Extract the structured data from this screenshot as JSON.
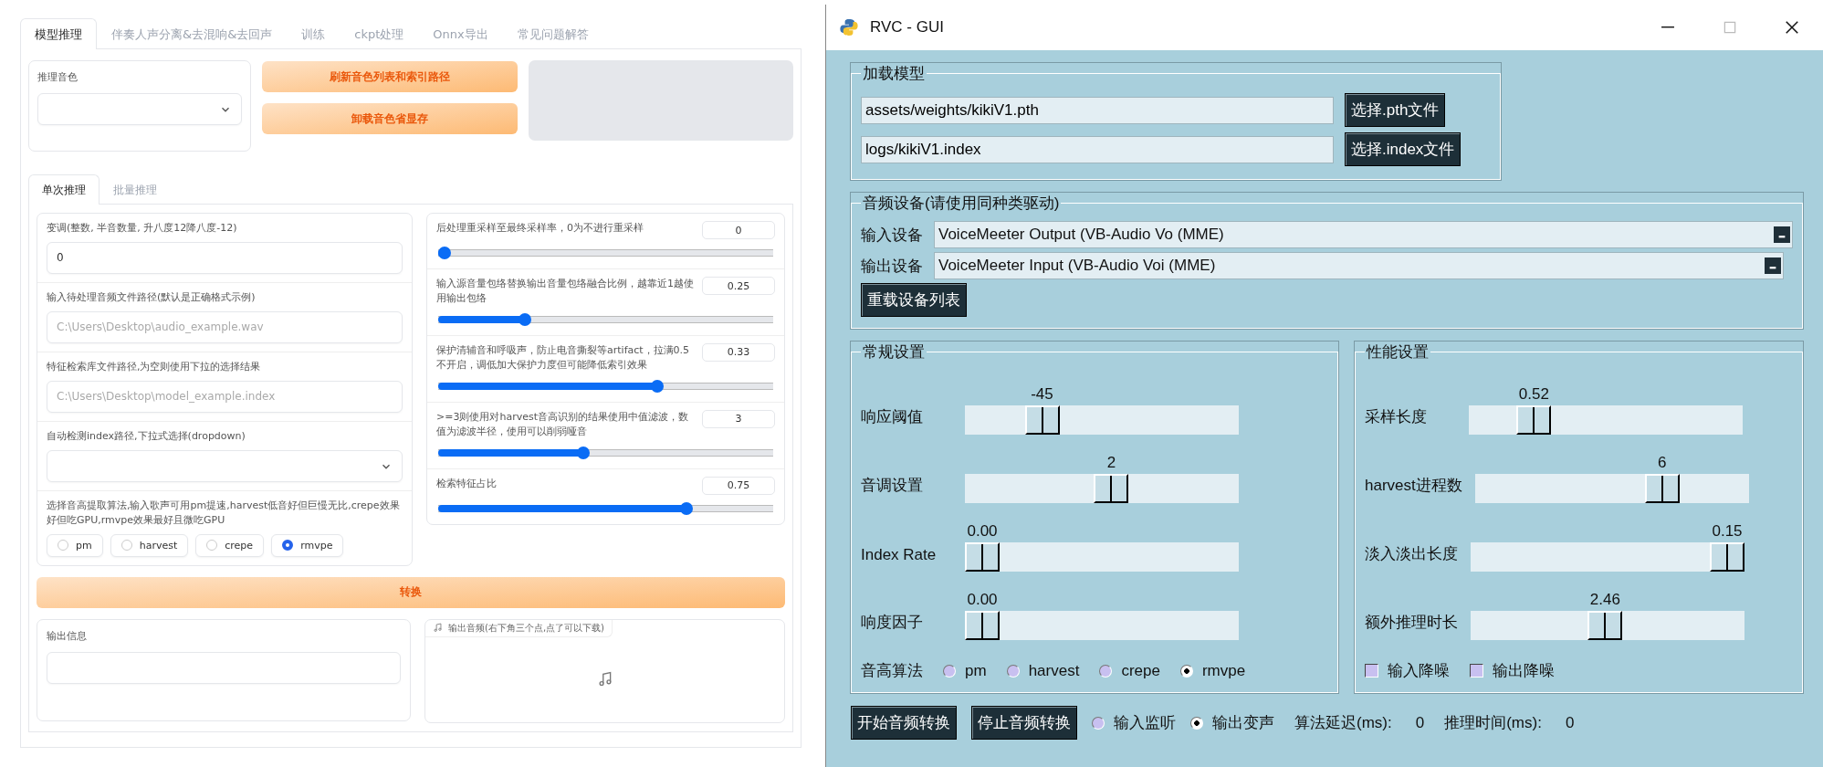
{
  "web_ui": {
    "tabs": [
      {
        "label": "模型推理",
        "selected": true
      },
      {
        "label": "伴奏人声分离&去混响&去回声",
        "selected": false
      },
      {
        "label": "训练",
        "selected": false
      },
      {
        "label": "ckpt处理",
        "selected": false
      },
      {
        "label": "Onnx导出",
        "selected": false
      },
      {
        "label": "常见问题解答",
        "selected": false
      }
    ],
    "voice_select": {
      "label": "推理音色"
    },
    "top_buttons": [
      "刷新音色列表和索引路径",
      "卸载音色省显存"
    ],
    "sub_tabs": [
      {
        "label": "单次推理",
        "selected": true
      },
      {
        "label": "批量推理",
        "selected": false
      }
    ],
    "fields": [
      {
        "kind": "text",
        "label": "变调(整数, 半音数量, 升八度12降八度-12)",
        "value": "0"
      },
      {
        "kind": "text",
        "label": "输入待处理音频文件路径(默认是正确格式示例)",
        "placeholder": "C:\\Users\\Desktop\\audio_example.wav"
      },
      {
        "kind": "text",
        "label": "特征检索库文件路径,为空则使用下拉的选择结果",
        "placeholder": "C:\\Users\\Desktop\\model_example.index"
      },
      {
        "kind": "dropdown",
        "label": "自动检测index路径,下拉式选择(dropdown)"
      },
      {
        "kind": "radio",
        "label": "选择音高提取算法,输入歌声可用pm提速,harvest低音好但巨慢无比,crepe效果好但吃GPU,rmvpe效果最好且微吃GPU",
        "options": [
          {
            "label": "pm",
            "selected": false
          },
          {
            "label": "harvest",
            "selected": false
          },
          {
            "label": "crepe",
            "selected": false
          },
          {
            "label": "rmvpe",
            "selected": true
          }
        ]
      }
    ],
    "sliders": [
      {
        "label": "后处理重采样至最终采样率，0为不进行重采样",
        "reading": "0",
        "level": 0
      },
      {
        "label": "输入源音量包络替换输出音量包络融合比例，越靠近1越使用输出包络",
        "reading": "0.25",
        "level": 0.25
      },
      {
        "label": "保护清辅音和呼吸声，防止电音撕裂等artifact，拉满0.5不开启，调低加大保护力度但可能降低索引效果",
        "reading": "0.33",
        "level": 0.66
      },
      {
        "label": ">=3则使用对harvest音高识别的结果使用中值滤波，数值为滤波半径，使用可以削弱哑音",
        "reading": "3",
        "level": 0.43
      },
      {
        "label": "检索特征占比",
        "reading": "0.75",
        "level": 0.75
      }
    ],
    "convert_button": "转换",
    "output_info": {
      "label": "输出信息"
    },
    "output_audio": {
      "label": "输出音频(右下角三个点,点了可以下载)"
    }
  },
  "rvc_window": {
    "title": "RVC - GUI",
    "load_model": {
      "title": "加载模型",
      "rows": [
        {
          "value": "assets/weights/kikiV1.pth",
          "button": "选择.pth文件"
        },
        {
          "value": "logs/kikiV1.index",
          "button": "选择.index文件"
        }
      ]
    },
    "audio_devices": {
      "title": "音频设备(请使用同种类驱动)",
      "rows": [
        {
          "label": "输入设备",
          "value": "VoiceMeeter Output (VB-Audio Vo (MME)"
        },
        {
          "label": "输出设备",
          "value": "VoiceMeeter Input (VB-Audio Voi (MME)"
        }
      ],
      "reload_button": "重载设备列表"
    },
    "general": {
      "title": "常规设置",
      "sliders": [
        {
          "label": "响应阈值",
          "reading": "-45",
          "level": 0.25
        },
        {
          "label": "音调设置",
          "reading": "2",
          "level": 0.54
        },
        {
          "label": "Index Rate",
          "reading": "0.00",
          "level": 0
        },
        {
          "label": "响度因子",
          "reading": "0.00",
          "level": 0
        }
      ],
      "pitch_algorithm": {
        "label": "音高算法",
        "options": [
          {
            "label": "pm",
            "selected": false
          },
          {
            "label": "harvest",
            "selected": false
          },
          {
            "label": "crepe",
            "selected": false
          },
          {
            "label": "rmvpe",
            "selected": true
          }
        ]
      }
    },
    "performance": {
      "title": "性能设置",
      "sliders": [
        {
          "label": "采样长度",
          "reading": "0.52",
          "level": 0.2
        },
        {
          "label": "harvest进程数",
          "reading": "6",
          "level": 0.71
        },
        {
          "label": "淡入淡出长度",
          "reading": "0.15",
          "level": 1
        },
        {
          "label": "额外推理时长",
          "reading": "2.46",
          "level": 0.49
        }
      ],
      "checkboxes": [
        {
          "label": "输入降噪",
          "checked": false
        },
        {
          "label": "输出降噪",
          "checked": false
        }
      ]
    },
    "bottom": {
      "buttons": [
        "开始音频转换",
        "停止音频转换"
      ],
      "modes": [
        {
          "label": "输入监听",
          "selected": false
        },
        {
          "label": "输出变声",
          "selected": true
        }
      ],
      "stats": [
        {
          "label": "算法延迟(ms):",
          "value": "0"
        },
        {
          "label": "推理时间(ms):",
          "value": "0"
        }
      ]
    }
  }
}
